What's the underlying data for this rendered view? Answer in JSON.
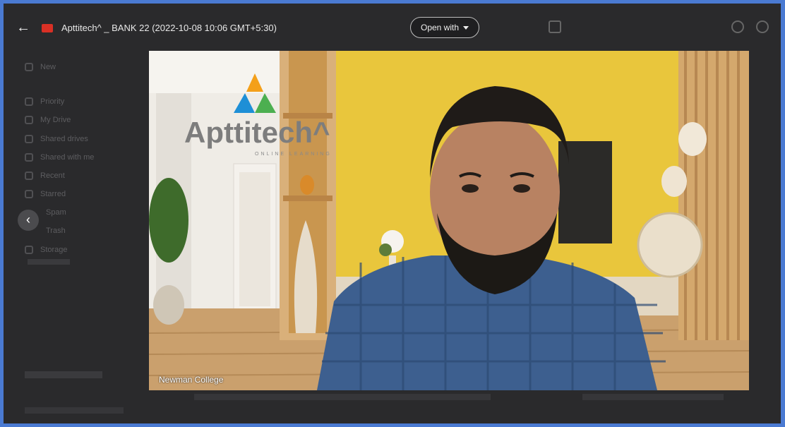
{
  "header": {
    "back_icon": "arrow-left-icon",
    "file_icon": "video-file-icon",
    "title": "Apttitech^ _ BANK 22 (2022-10-08 10:06 GMT+5:30)",
    "open_with_label": "Open with",
    "right_icons": [
      "grid-icon",
      "help-icon",
      "settings-icon"
    ]
  },
  "sidebar": {
    "items": [
      "New",
      "Priority",
      "My Drive",
      "Shared drives",
      "Shared with me",
      "Recent",
      "Starred",
      "Spam",
      "Trash",
      "Storage"
    ]
  },
  "video": {
    "logo_text": "Apttitech^",
    "logo_tagline": "ONLINE LEARNING",
    "caption": "Newman College",
    "colors": {
      "wall": "#e8c840",
      "shirt": "#3d5f8f",
      "wood": "#c89a5e"
    }
  }
}
